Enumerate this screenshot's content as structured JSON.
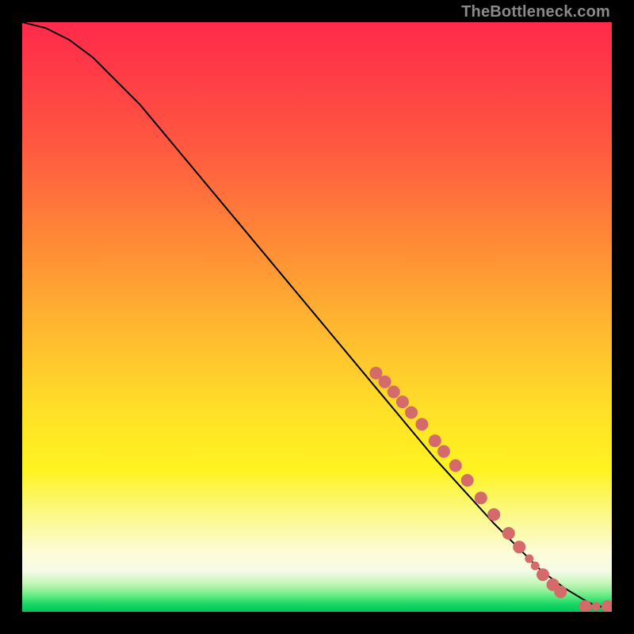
{
  "watermark": "TheBottleneck.com",
  "chart_data": {
    "type": "line",
    "title": "",
    "xlabel": "",
    "ylabel": "",
    "xlim": [
      0,
      100
    ],
    "ylim": [
      0,
      100
    ],
    "grid": false,
    "legend": false,
    "series": [
      {
        "name": "curve",
        "x": [
          0,
          4,
          8,
          12,
          20,
          30,
          40,
          50,
          60,
          70,
          80,
          88,
          92,
          95,
          96.5,
          97.5,
          100
        ],
        "y": [
          100,
          99,
          97,
          94,
          86,
          74,
          62,
          50,
          38,
          26,
          15,
          7,
          4,
          2.2,
          1.4,
          0.9,
          0.8
        ]
      }
    ],
    "points": {
      "name": "dots",
      "color": "#d46a6a",
      "radius_main": 8,
      "radius_small": 5.5,
      "coords": [
        {
          "x": 60.0,
          "y": 40.5
        },
        {
          "x": 61.5,
          "y": 39.0
        },
        {
          "x": 63.0,
          "y": 37.3
        },
        {
          "x": 64.5,
          "y": 35.6
        },
        {
          "x": 66.0,
          "y": 33.8
        },
        {
          "x": 67.8,
          "y": 31.8
        },
        {
          "x": 70.0,
          "y": 29.0
        },
        {
          "x": 71.5,
          "y": 27.2
        },
        {
          "x": 73.5,
          "y": 24.8
        },
        {
          "x": 75.5,
          "y": 22.3
        },
        {
          "x": 77.8,
          "y": 19.3
        },
        {
          "x": 80.0,
          "y": 16.5
        },
        {
          "x": 82.5,
          "y": 13.3
        },
        {
          "x": 84.3,
          "y": 11.0
        },
        {
          "x": 86.0,
          "y": 9.0,
          "small": true
        },
        {
          "x": 87.0,
          "y": 7.8,
          "small": true
        },
        {
          "x": 88.3,
          "y": 6.3
        },
        {
          "x": 90.0,
          "y": 4.6
        },
        {
          "x": 91.3,
          "y": 3.4
        },
        {
          "x": 95.5,
          "y": 0.9
        },
        {
          "x": 97.3,
          "y": 0.9,
          "small": true
        },
        {
          "x": 99.3,
          "y": 0.9
        }
      ]
    }
  }
}
